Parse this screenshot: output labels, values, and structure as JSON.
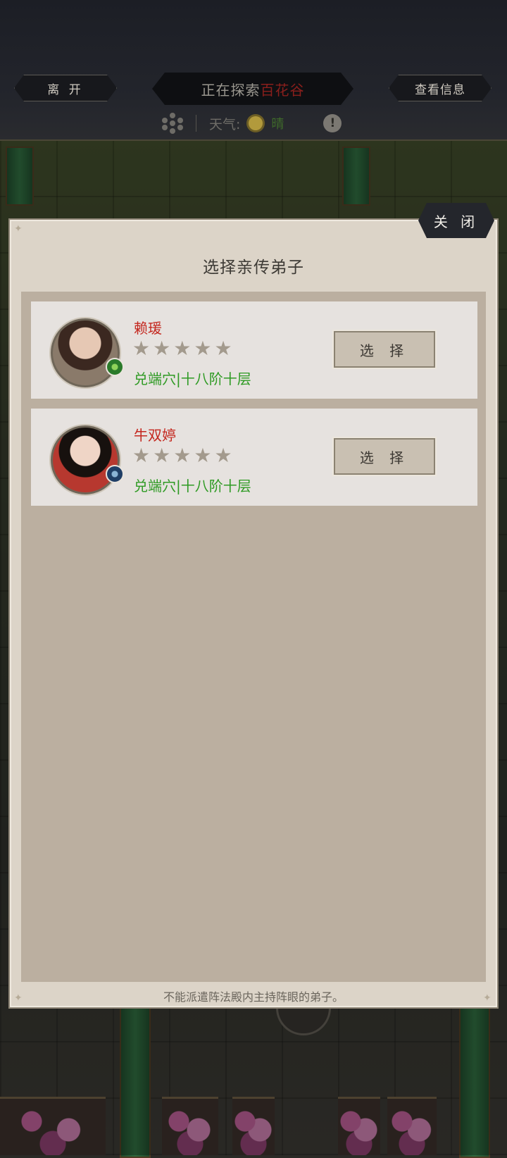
{
  "topbar": {
    "leave_label": "离 开",
    "info_label": "查看信息",
    "exploring_prefix": "正在探索",
    "exploring_place": "百花谷",
    "weather_label": "天气:",
    "weather_value": "晴"
  },
  "modal": {
    "close_label": "关 闭",
    "title": "选择亲传弟子",
    "disciples": [
      {
        "name": "赖瑗",
        "stars": 5,
        "realm": "兑端穴|十八阶十层",
        "select_label": "选 择"
      },
      {
        "name": "牛双婷",
        "stars": 5,
        "realm": "兑端穴|十八阶十层",
        "select_label": "选 择"
      }
    ],
    "footnote": "不能派遣阵法殿内主持阵眼的弟子。"
  }
}
